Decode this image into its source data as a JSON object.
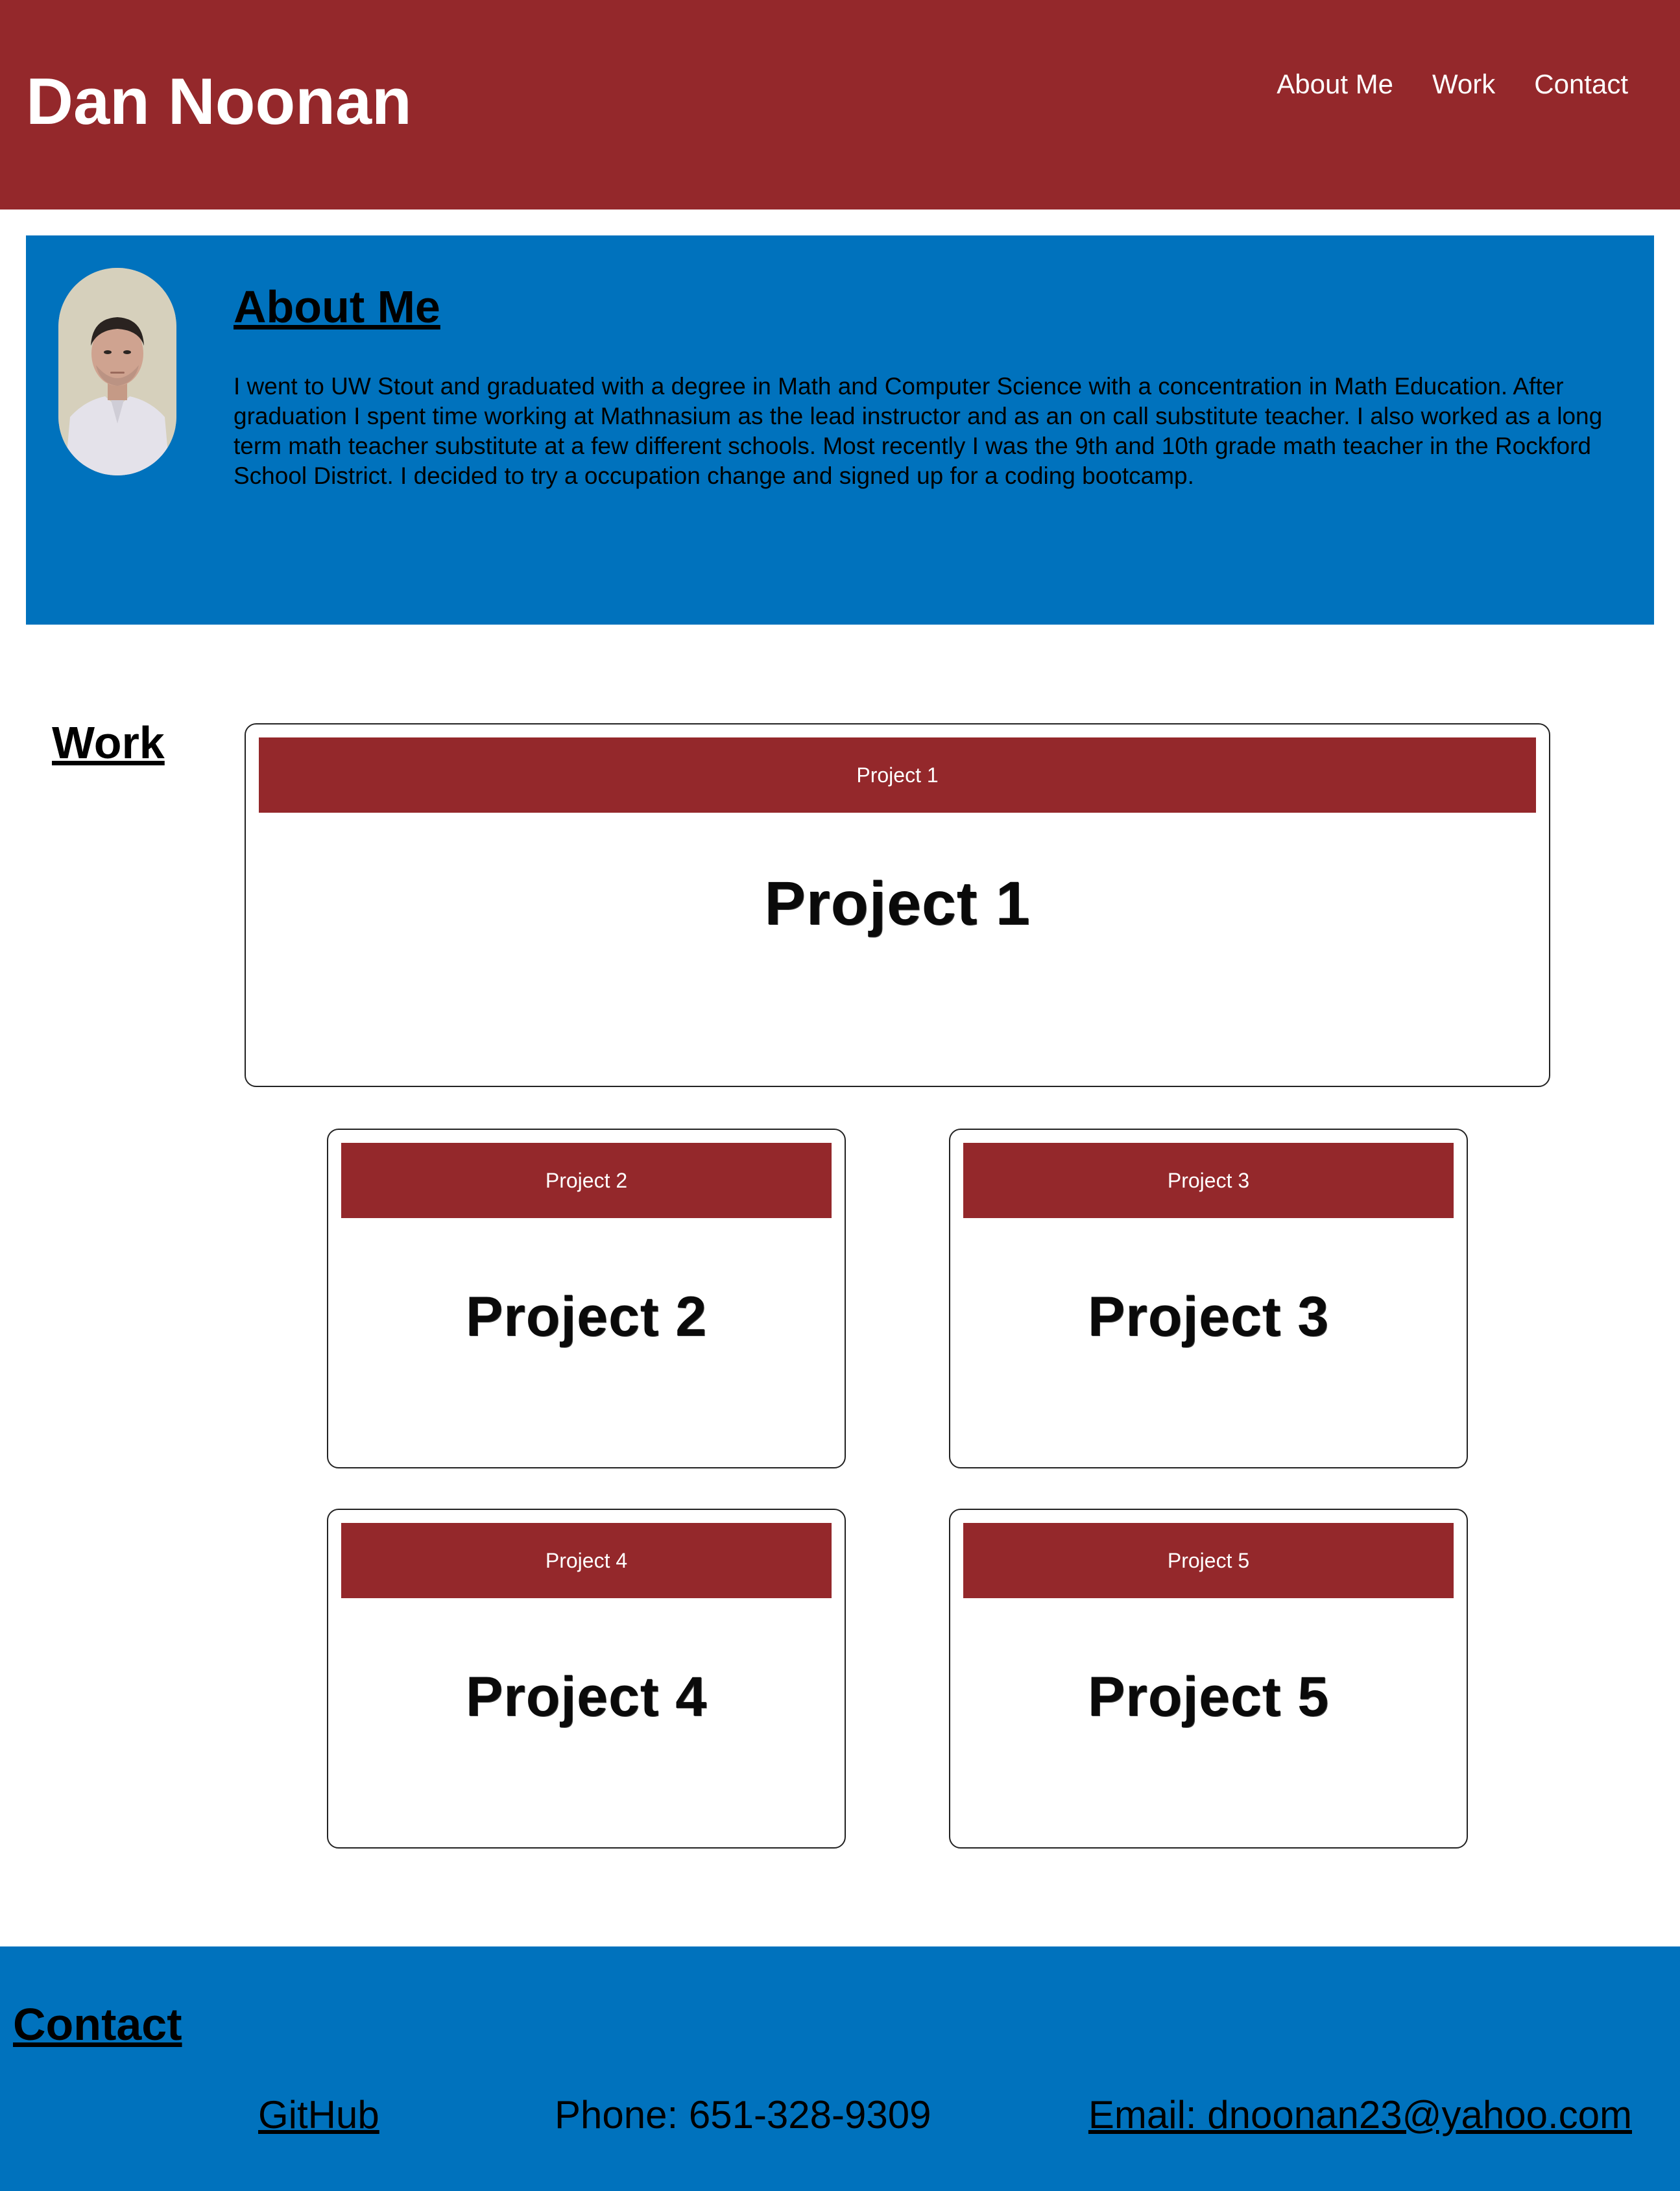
{
  "header": {
    "site_title": "Dan Noonan",
    "nav": [
      "About Me",
      "Work",
      "Contact"
    ]
  },
  "about": {
    "heading": "About Me",
    "body": "I went to UW Stout and graduated with a degree in Math and Computer Science with a concentration in Math Education. After graduation I spent time working at Mathnasium as the lead instructor and as an on call substitute teacher. I also worked as a long term math teacher substitute at a few different schools. Most recently I was the 9th and 10th grade math teacher in the Rockford School District. I decided to try a occupation change and signed up for a coding bootcamp."
  },
  "work": {
    "heading": "Work",
    "projects": [
      {
        "bar_label": "Project 1",
        "image_text": "Project 1"
      },
      {
        "bar_label": "Project 2",
        "image_text": "Project 2"
      },
      {
        "bar_label": "Project 3",
        "image_text": "Project 3"
      },
      {
        "bar_label": "Project 4",
        "image_text": "Project 4"
      },
      {
        "bar_label": "Project 5",
        "image_text": "Project 5"
      }
    ]
  },
  "contact": {
    "heading": "Contact",
    "github": "GitHub",
    "phone": "Phone: 651-328-9309",
    "email": "Email: dnoonan23@yahoo.com"
  },
  "colors": {
    "header_bg": "#94282b",
    "section_bg": "#0072bd",
    "card_bar_bg": "#94282b"
  }
}
